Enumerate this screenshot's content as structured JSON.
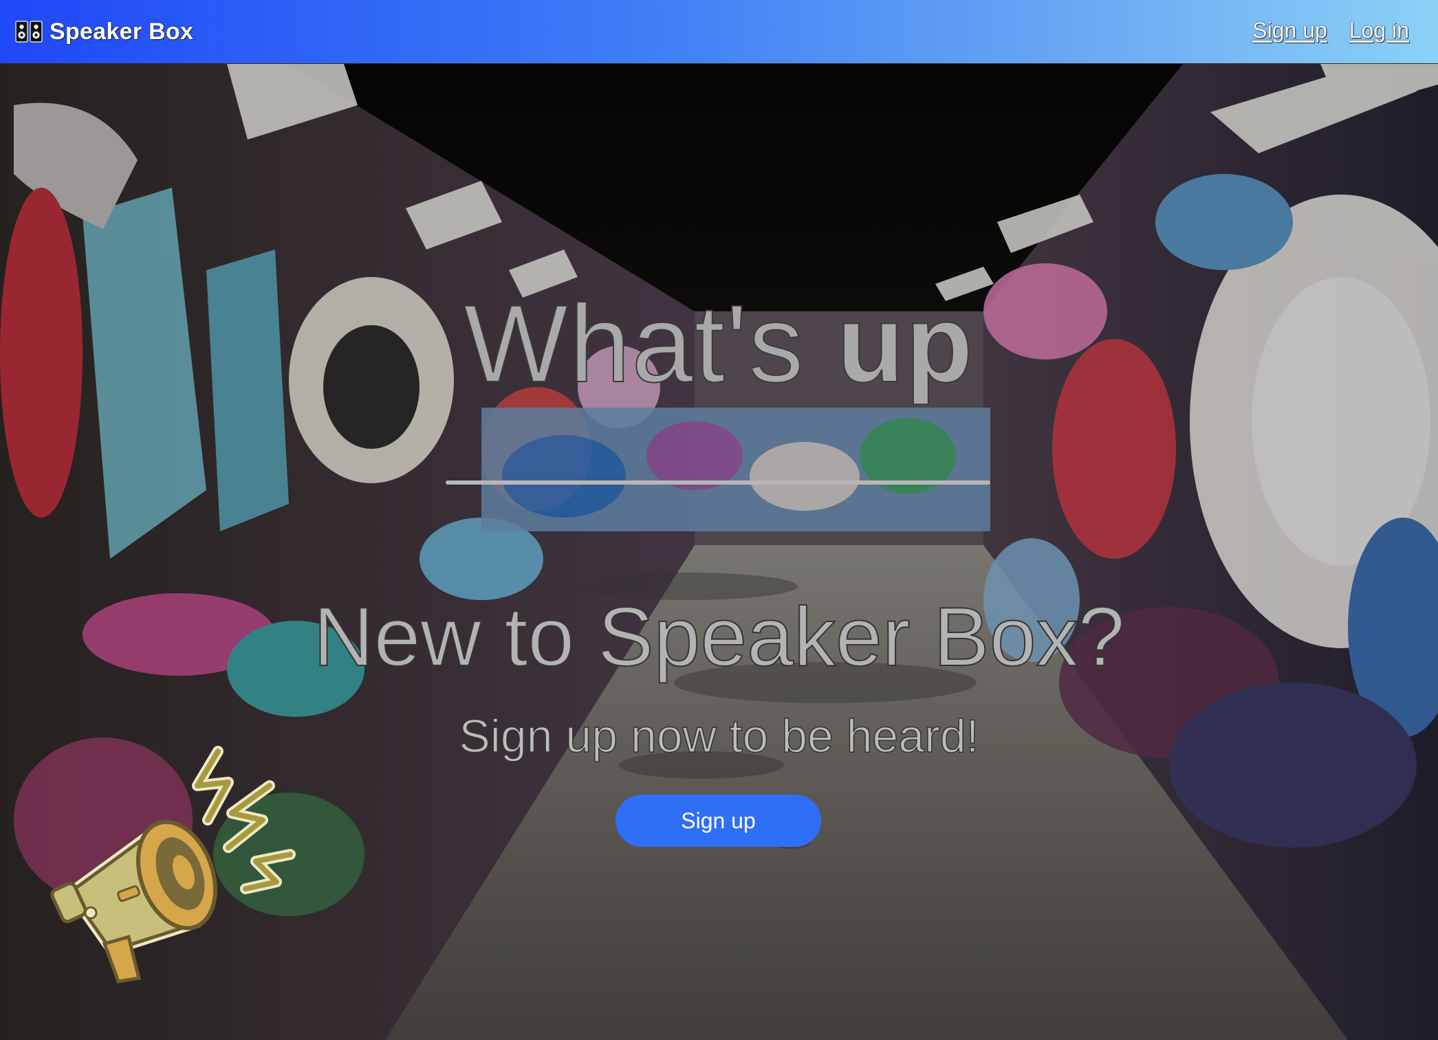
{
  "navbar": {
    "brand_icon": "speaker-icon",
    "brand_name": "Speaker Box",
    "links": [
      {
        "label": "Sign up"
      },
      {
        "label": "Log in"
      }
    ],
    "gradient_colors": [
      "#1f48f7",
      "#8bd1f7"
    ]
  },
  "hero": {
    "background": "graffiti-tunnel-photo",
    "headline_light": "What's",
    "headline_bold": "up",
    "subheading": "New to Speaker Box?",
    "tagline": "Sign up now to be heard!",
    "cta_label": "Sign up",
    "cta_color": "#2f6ff6",
    "decoration_icon": "megaphone-icon"
  }
}
